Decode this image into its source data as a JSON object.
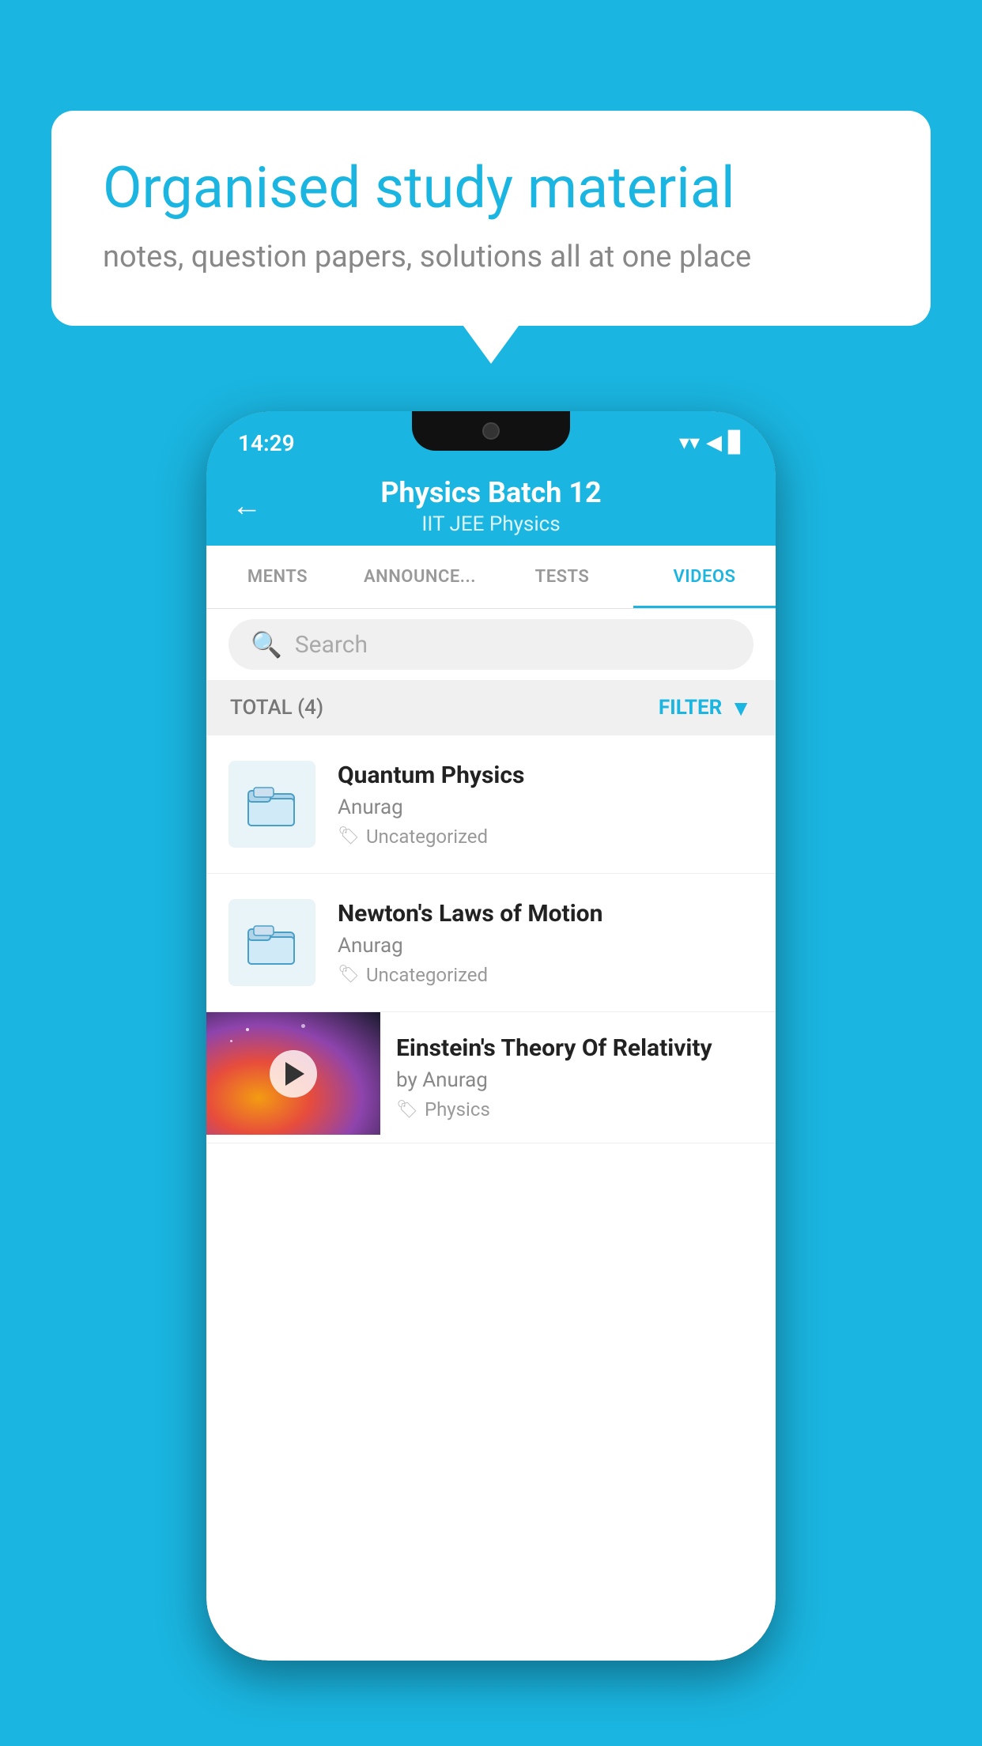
{
  "background_color": "#1ab5e0",
  "speech_bubble": {
    "title": "Organised study material",
    "subtitle": "notes, question papers, solutions all at one place"
  },
  "status_bar": {
    "time": "14:29",
    "wifi": "▼",
    "signal": "▲",
    "battery": "▊"
  },
  "header": {
    "back_label": "←",
    "title": "Physics Batch 12",
    "subtitle": "IIT JEE   Physics"
  },
  "tabs": [
    {
      "label": "MENTS",
      "active": false
    },
    {
      "label": "ANNOUNCEMENTS",
      "active": false
    },
    {
      "label": "TESTS",
      "active": false
    },
    {
      "label": "VIDEOS",
      "active": true
    }
  ],
  "search": {
    "placeholder": "Search"
  },
  "filter": {
    "total_label": "TOTAL (4)",
    "filter_label": "FILTER"
  },
  "videos": [
    {
      "id": 1,
      "title": "Quantum Physics",
      "author": "Anurag",
      "tag": "Uncategorized",
      "has_thumbnail": false
    },
    {
      "id": 2,
      "title": "Newton's Laws of Motion",
      "author": "Anurag",
      "tag": "Uncategorized",
      "has_thumbnail": false
    },
    {
      "id": 3,
      "title": "Einstein's Theory Of Relativity",
      "author": "by Anurag",
      "tag": "Physics",
      "has_thumbnail": true
    }
  ]
}
